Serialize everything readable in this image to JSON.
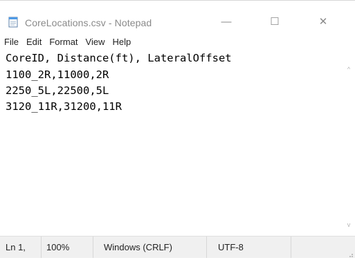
{
  "window": {
    "title": "CoreLocations.csv - Notepad",
    "controls": {
      "minimize": "—",
      "maximize": "☐",
      "close": "✕"
    }
  },
  "menu": [
    "File",
    "Edit",
    "Format",
    "View",
    "Help"
  ],
  "editor": {
    "lines": [
      "CoreID, Distance(ft), LateralOffset",
      "1100_2R,11000,2R",
      "2250_5L,22500,5L",
      "3120_11R,31200,11R"
    ]
  },
  "scrollbar": {
    "up": "^",
    "down": "v"
  },
  "status": {
    "position": "Ln 1,",
    "zoom": "100%",
    "line_ending": "Windows (CRLF)",
    "encoding": "UTF-8"
  },
  "colors": {
    "title_text": "#8a8a8a",
    "status_bg": "#f0f0f0"
  },
  "icons": {
    "app": "notepad-icon",
    "grip": "resize-grip-icon"
  }
}
